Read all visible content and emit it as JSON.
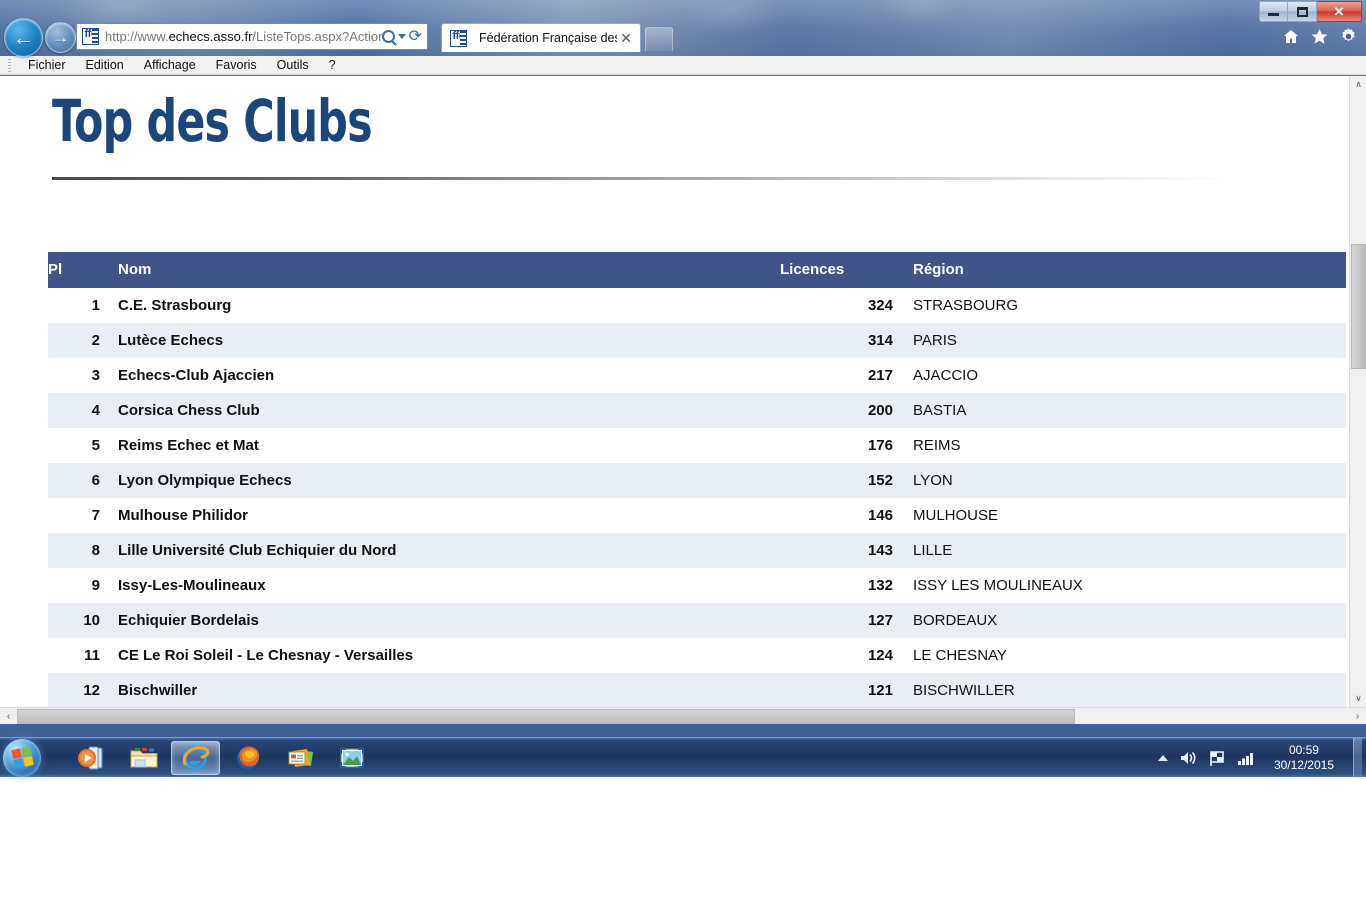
{
  "window": {
    "minimize_label": "minimize",
    "restore_label": "restore",
    "close_label": "✕"
  },
  "browser": {
    "back_glyph": "←",
    "forward_glyph": "→",
    "url": "http://www.echecs.asso.fr/ListeTops.aspx?Action=CLU",
    "url_domain": "echecs.asso.fr",
    "url_prefix": "http://www.",
    "url_suffix": "/ListeTops.aspx?Action=CLU",
    "reload_glyph": "⟳",
    "tab_title": "Fédération Française des Éc...",
    "tab_close_glyph": "✕",
    "menu": [
      "Fichier",
      "Edition",
      "Affichage",
      "Favoris",
      "Outils",
      "?"
    ]
  },
  "page": {
    "title": "Top des Clubs",
    "table": {
      "headers": [
        "Pl",
        "Nom",
        "Licences",
        "Région"
      ],
      "rows": [
        {
          "pl": "1",
          "nom": "C.E. Strasbourg",
          "licences": "324",
          "region": "STRASBOURG"
        },
        {
          "pl": "2",
          "nom": "Lutèce Echecs",
          "licences": "314",
          "region": "PARIS"
        },
        {
          "pl": "3",
          "nom": "Echecs-Club Ajaccien",
          "licences": "217",
          "region": "AJACCIO"
        },
        {
          "pl": "4",
          "nom": "Corsica Chess Club",
          "licences": "200",
          "region": "BASTIA"
        },
        {
          "pl": "5",
          "nom": "Reims Echec et Mat",
          "licences": "176",
          "region": "REIMS"
        },
        {
          "pl": "6",
          "nom": "Lyon Olympique Echecs",
          "licences": "152",
          "region": "LYON"
        },
        {
          "pl": "7",
          "nom": "Mulhouse Philidor",
          "licences": "146",
          "region": "MULHOUSE"
        },
        {
          "pl": "8",
          "nom": "Lille Université Club Echiquier du Nord",
          "licences": "143",
          "region": "LILLE"
        },
        {
          "pl": "9",
          "nom": "Issy-Les-Moulineaux",
          "licences": "132",
          "region": "ISSY LES MOULINEAUX"
        },
        {
          "pl": "10",
          "nom": "Echiquier Bordelais",
          "licences": "127",
          "region": "BORDEAUX"
        },
        {
          "pl": "11",
          "nom": "CE Le Roi Soleil - Le Chesnay - Versailles",
          "licences": "124",
          "region": "LE CHESNAY"
        },
        {
          "pl": "12",
          "nom": "Bischwiller",
          "licences": "121",
          "region": "BISCHWILLER"
        }
      ]
    }
  },
  "scrollbars": {
    "v_up_glyph": "∧",
    "v_down_glyph": "∨",
    "h_left_glyph": "‹",
    "h_right_glyph": "›"
  },
  "taskbar": {
    "start_label": "Start",
    "items": [
      {
        "name": "windows-media-player",
        "label": "Windows Media Player"
      },
      {
        "name": "windows-explorer",
        "label": "Explorateur Windows"
      },
      {
        "name": "internet-explorer",
        "label": "Internet Explorer"
      },
      {
        "name": "firefox",
        "label": "Mozilla Firefox"
      },
      {
        "name": "windows-live-mail",
        "label": "Windows Live Mail"
      },
      {
        "name": "photo-viewer",
        "label": "Visionneuse de photos"
      }
    ],
    "clock_time": "00:59",
    "clock_date": "30/12/2015"
  },
  "colors": {
    "header_blue": "#3f5489",
    "title_blue": "#1a4679",
    "row_alt": "#e9edf4"
  }
}
